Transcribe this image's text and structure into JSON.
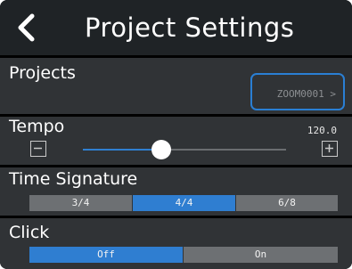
{
  "header": {
    "title": "Project Settings"
  },
  "projects": {
    "label": "Projects",
    "value": "ZOOM0001  >"
  },
  "tempo": {
    "label": "Tempo",
    "value": "120.0",
    "level_fraction": 0.4
  },
  "time_signature": {
    "label": "Time Signature",
    "options": [
      "3/4",
      "4/4",
      "6/8"
    ],
    "selected": "4/4"
  },
  "click": {
    "label": "Click",
    "options": [
      "Off",
      "On"
    ],
    "selected": "Off"
  },
  "colors": {
    "accent": "#2f7ed1",
    "row_bg": "#303336",
    "segment_off": "#6d7073"
  }
}
